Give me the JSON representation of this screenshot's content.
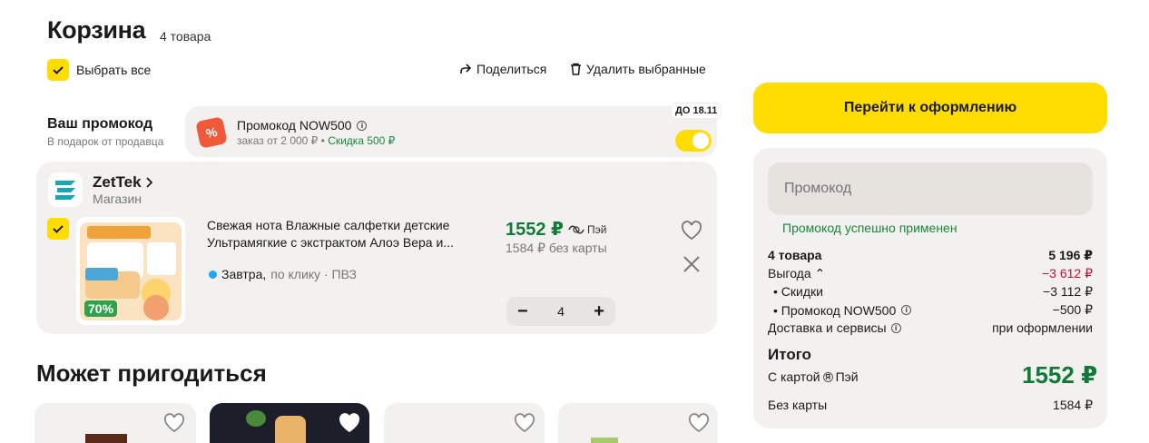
{
  "header": {
    "title": "Корзина",
    "count": "4 товара",
    "select_all": "Выбрать все",
    "share": "Поделиться",
    "delete_selected": "Удалить выбранные"
  },
  "promo": {
    "label": "Ваш промокод",
    "sublabel": "В подарок от продавца",
    "name": "Промокод NOW500",
    "condition": "заказ от 2 000 ₽ •",
    "discount": "Скидка 500 ₽",
    "until": "ДО 18.11",
    "enabled": true,
    "icon": "%"
  },
  "shop": {
    "name": "ZetTek",
    "type": "Магазин",
    "item": {
      "title": "Свежая нота Влажные салфетки детские Ультрамягкие с экстрактом Алоэ Вера и...",
      "discount_badge": "70%",
      "delivery_day": "Завтра,",
      "delivery_rest": "по клику · ПВЗ",
      "price": "1552 ₽",
      "pay_label": "Пэй",
      "price_without_card": "1584 ₽ без карты",
      "quantity": "4",
      "minus": "−",
      "plus": "+"
    }
  },
  "recommendations": {
    "title": "Может пригодиться"
  },
  "summary": {
    "checkout_button": "Перейти к оформлению",
    "promo_placeholder": "Промокод",
    "promo_success": "Промокод успешно применен",
    "items_label": "4 товара",
    "items_value": "5 196 ₽",
    "savings_label": "Выгода ⌃",
    "savings_value": "−3 612 ₽",
    "discounts_label": "• Скидки",
    "discounts_value": "−3 112 ₽",
    "promo_label": "• Промокод NOW500",
    "promo_value": "−500 ₽",
    "delivery_label": "Доставка и сервисы",
    "delivery_value": "при оформлении",
    "total_label": "Итого",
    "with_card_label": "С картой",
    "with_card_pay": "Пэй",
    "total_price": "1552 ₽",
    "without_card_label": "Без карты",
    "without_card_value": "1584 ₽"
  },
  "colors": {
    "accent": "#ffdd00",
    "price_green": "#117a38",
    "success_green": "#18883a",
    "savings_red": "#c8102e"
  }
}
